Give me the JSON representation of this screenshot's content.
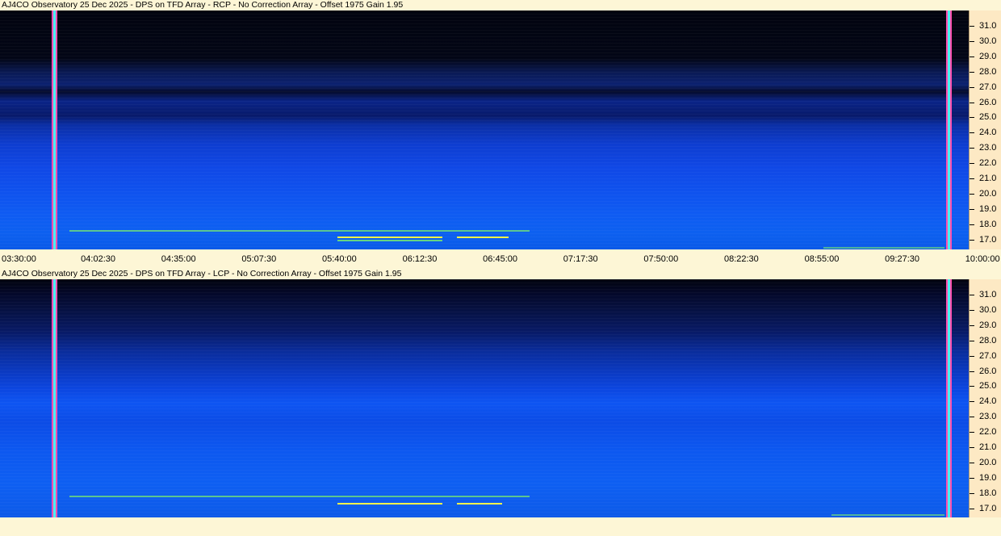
{
  "panels": [
    {
      "title": "AJ4CO Observatory 25 Dec 2025 - DPS on TFD Array  - RCP  -  No Correction Array  -  Offset 1975  Gain 1.95",
      "polarization": "RCP"
    },
    {
      "title": "AJ4CO Observatory 25 Dec 2025 - DPS on TFD Array  - LCP  -  No Correction Array  -  Offset 1975  Gain 1.95",
      "polarization": "LCP"
    }
  ],
  "freq_axis": {
    "ticks": [
      "31.0",
      "30.0",
      "29.0",
      "28.0",
      "27.0",
      "26.0",
      "25.0",
      "24.0",
      "23.0",
      "22.0",
      "21.0",
      "20.0",
      "19.0",
      "18.0",
      "17.0"
    ]
  },
  "time_axis": {
    "ticks": [
      "03:30:00",
      "04:02:30",
      "04:35:00",
      "05:07:30",
      "05:40:00",
      "06:12:30",
      "06:45:00",
      "07:17:30",
      "07:50:00",
      "08:22:30",
      "08:55:00",
      "09:27:30",
      "10:00:00"
    ]
  },
  "colors": {
    "background": "#fdf6d6",
    "scale_background": "#fde9c4",
    "signal_yellow": "#f2f24a",
    "signal_green": "#7cf06a",
    "vertical_marker_magenta": "#ff4fb0",
    "vertical_marker_cyan": "#48f0f0"
  }
}
